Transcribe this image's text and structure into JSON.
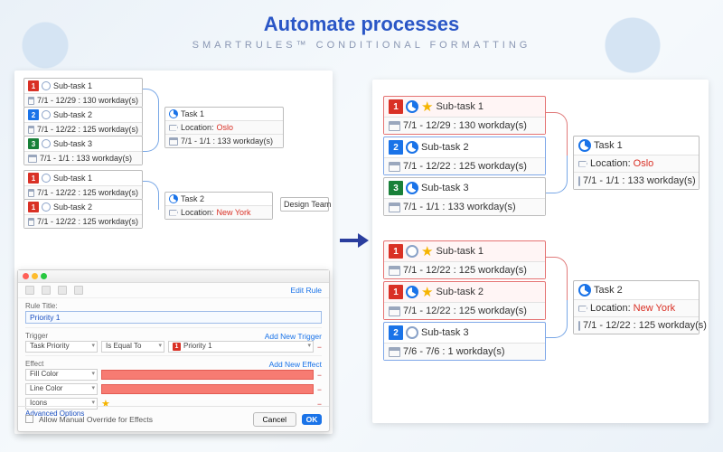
{
  "header": {
    "title": "Automate processes",
    "subtitle": "SMARTRULES™ CONDITIONAL FORMATTING"
  },
  "left_map": {
    "groupA": {
      "t1": {
        "pri": "1",
        "pri_color": "red",
        "name": "Sub-task 1",
        "date": "7/1 - 12/29 : 130 workday(s)"
      },
      "t2": {
        "pri": "2",
        "pri_color": "blue",
        "name": "Sub-task 2",
        "date": "7/1 - 12/22 : 125 workday(s)"
      },
      "t3": {
        "pri": "3",
        "pri_color": "green",
        "name": "Sub-task 3",
        "date": "7/1 - 1/1 : 133 workday(s)"
      },
      "parent": {
        "name": "Task 1",
        "loc_label": "Location:",
        "loc_value": "Oslo",
        "date": "7/1 - 1/1 : 133 workday(s)"
      }
    },
    "groupB": {
      "t1": {
        "pri": "1",
        "pri_color": "red",
        "name": "Sub-task 1",
        "date": "7/1 - 12/22 : 125 workday(s)"
      },
      "t2": {
        "pri": "1",
        "pri_color": "red",
        "name": "Sub-task 2",
        "date": "7/1 - 12/22 : 125 workday(s)"
      },
      "parent": {
        "name": "Task 2",
        "loc_label": "Location:",
        "loc_value": "New York"
      },
      "side": {
        "name": "Design Team"
      }
    }
  },
  "right_map": {
    "groupA": {
      "t1": {
        "pri": "1",
        "pri_color": "red",
        "name": "Sub-task 1",
        "date": "7/1 - 12/29 : 130 workday(s)"
      },
      "t2": {
        "pri": "2",
        "pri_color": "blue",
        "name": "Sub-task 2",
        "date": "7/1 - 12/22 : 125 workday(s)"
      },
      "t3": {
        "pri": "3",
        "pri_color": "green",
        "name": "Sub-task 3",
        "date": "7/1 - 1/1 : 133 workday(s)"
      },
      "parent": {
        "name": "Task 1",
        "loc_label": "Location:",
        "loc_value": "Oslo",
        "date": "7/1 - 1/1 : 133 workday(s)"
      }
    },
    "groupB": {
      "t1": {
        "pri": "1",
        "pri_color": "red",
        "name": "Sub-task 1",
        "date": "7/1 - 12/22 : 125 workday(s)"
      },
      "t2": {
        "pri": "1",
        "pri_color": "red",
        "name": "Sub-task 2",
        "date": "7/1 - 12/22 : 125 workday(s)"
      },
      "t3": {
        "pri": "2",
        "pri_color": "blue",
        "name": "Sub-task 3",
        "date": "7/6 - 7/6 : 1 workday(s)"
      },
      "parent": {
        "name": "Task 2",
        "loc_label": "Location:",
        "loc_value": "New York",
        "date": "7/1 - 12/22 : 125 workday(s)"
      }
    }
  },
  "dialog": {
    "toolbar": {
      "edit_rule": "Edit Rule"
    },
    "rule_title_label": "Rule Title:",
    "rule_title_value": "Priority 1",
    "trigger": {
      "label": "Trigger",
      "add": "Add New Trigger",
      "field": "Task Priority",
      "op": "Is Equal To",
      "value": "Priority 1"
    },
    "effect": {
      "label": "Effect",
      "add": "Add New Effect",
      "rows": {
        "fill": "Fill Color",
        "line": "Line Color",
        "icons": "Icons"
      }
    },
    "allow_override": "Allow Manual Override for Effects",
    "advanced": "Advanced Options",
    "cancel": "Cancel",
    "ok": "OK"
  }
}
